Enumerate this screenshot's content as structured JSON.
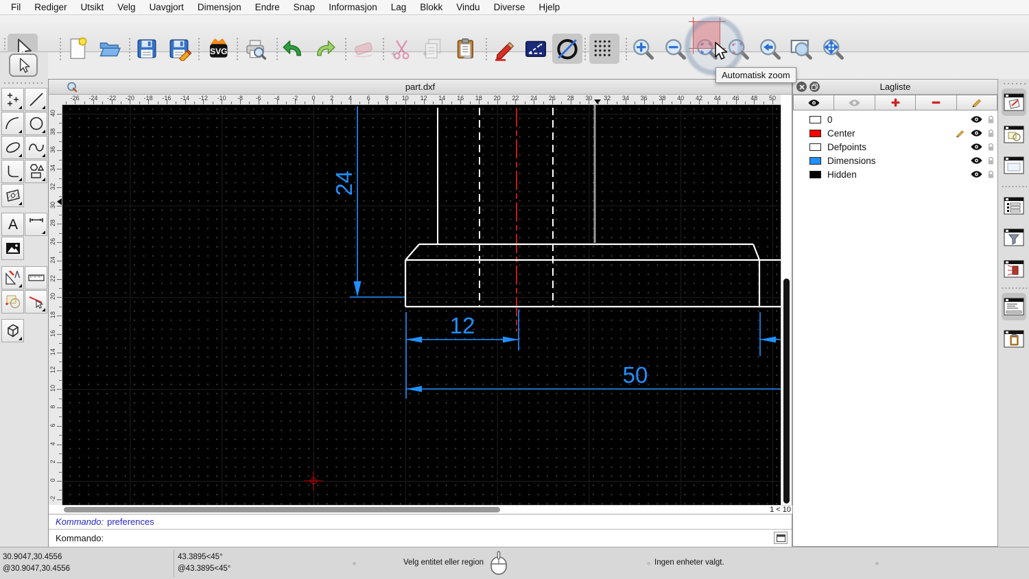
{
  "menu": {
    "items": [
      "Fil",
      "Rediger",
      "Utsikt",
      "Velg",
      "Uavgjort",
      "Dimensjon",
      "Endre",
      "Snap",
      "Informasjon",
      "Lag",
      "Blokk",
      "Vindu",
      "Diverse",
      "Hjelp"
    ]
  },
  "toolbar": {
    "svg_label": "SVG",
    "tooltip": "Automatisk zoom"
  },
  "window": {
    "title": "part.dxf",
    "zoom_indicator": "1 < 10"
  },
  "rulers": {
    "horizontal": [
      -26,
      -24,
      -22,
      -20,
      -18,
      -16,
      -14,
      -12,
      -10,
      -8,
      -6,
      -4,
      -2,
      0,
      2,
      4,
      6,
      8,
      10,
      12,
      14,
      16,
      18,
      20,
      22,
      24,
      26,
      28,
      30,
      32,
      34,
      36,
      38,
      40,
      42,
      44,
      46,
      48,
      50
    ],
    "vertical": [
      40,
      38,
      36,
      34,
      32,
      30,
      28,
      26,
      24,
      22,
      20,
      18,
      16,
      14,
      12,
      10,
      8,
      6,
      4,
      2,
      0,
      -2
    ]
  },
  "palette": {
    "text_glyph": "A"
  },
  "layer_panel": {
    "title": "Lagliste",
    "layers": [
      {
        "name": "0",
        "color": "#ffffff",
        "editing": false
      },
      {
        "name": "Center",
        "color": "#ff0000",
        "editing": true
      },
      {
        "name": "Defpoints",
        "color": "#ffffff",
        "editing": false
      },
      {
        "name": "Dimensions",
        "color": "#2090ff",
        "editing": false
      },
      {
        "name": "Hidden",
        "color": "#000000",
        "editing": false
      }
    ]
  },
  "command": {
    "history_prompt": "Kommando:",
    "history_text": "preferences",
    "prompt": "Kommando:"
  },
  "status": {
    "coord_abs": "30.9047,30.4556",
    "coord_rel": "@30.9047,30.4556",
    "polar_abs": "43.3895<45°",
    "polar_rel": "@43.3895<45°",
    "hint": "Velg entitet eller region",
    "selection": "Ingen enheter valgt."
  },
  "drawing": {
    "dim_height": "24",
    "dim_small": "12",
    "dim_total": "50"
  },
  "colors": {
    "dimension_blue": "#2090ff",
    "center_red": "#ff2222",
    "highlight_red": "#cf4b4b",
    "canvas_bg": "#000000"
  }
}
